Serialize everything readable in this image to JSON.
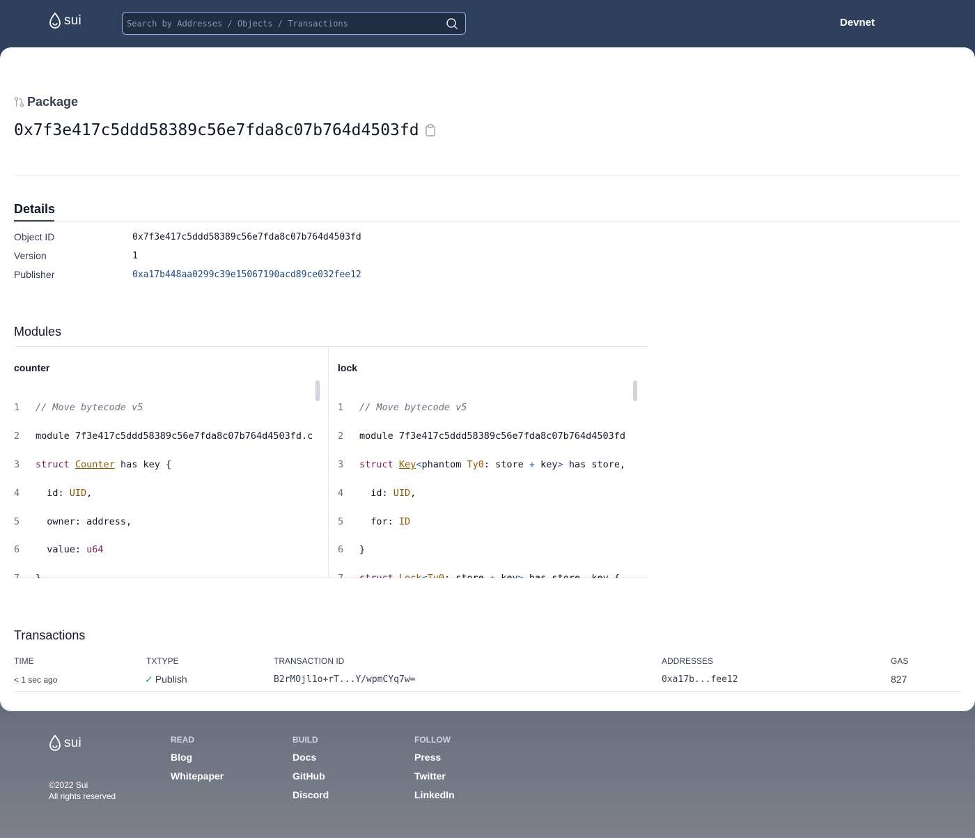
{
  "header": {
    "logo_text": "sui",
    "search_placeholder": "Search by Addresses / Objects / Transactions",
    "network": "Devnet"
  },
  "package": {
    "type_label": "Package",
    "id": "0x7f3e417c5ddd58389c56e7fda8c07b764d4503fd"
  },
  "details": {
    "title": "Details",
    "rows": [
      {
        "label": "Object ID",
        "value": "0x7f3e417c5ddd58389c56e7fda8c07b764d4503fd"
      },
      {
        "label": "Version",
        "value": "1"
      },
      {
        "label": "Publisher",
        "value": "0xa17b448aa0299c39e15067190acd89ce032fee12"
      }
    ]
  },
  "modules": {
    "title": "Modules",
    "items": [
      {
        "name": "counter"
      },
      {
        "name": "lock"
      }
    ]
  },
  "transactions": {
    "title": "Transactions",
    "headers": [
      "TIME",
      "TXTYPE",
      "TRANSACTION ID",
      "ADDRESSES",
      "GAS"
    ],
    "rows": [
      {
        "time": "< 1 sec ago",
        "txtype": "Publish",
        "id": "B2rMOjl1o+rT...Y/wpmCYq7w=",
        "addresses": "0xa17b...fee12",
        "gas": "827"
      }
    ]
  },
  "footer": {
    "logo_text": "sui",
    "columns": [
      {
        "head": "READ",
        "items": [
          "Blog",
          "Whitepaper"
        ]
      },
      {
        "head": "BUILD",
        "items": [
          "Docs",
          "GitHub",
          "Discord"
        ]
      },
      {
        "head": "FOLLOW",
        "items": [
          "Press",
          "Twitter",
          "LinkedIn"
        ]
      }
    ],
    "copyright": "©2022 Sui",
    "rights": "All rights reserved"
  }
}
